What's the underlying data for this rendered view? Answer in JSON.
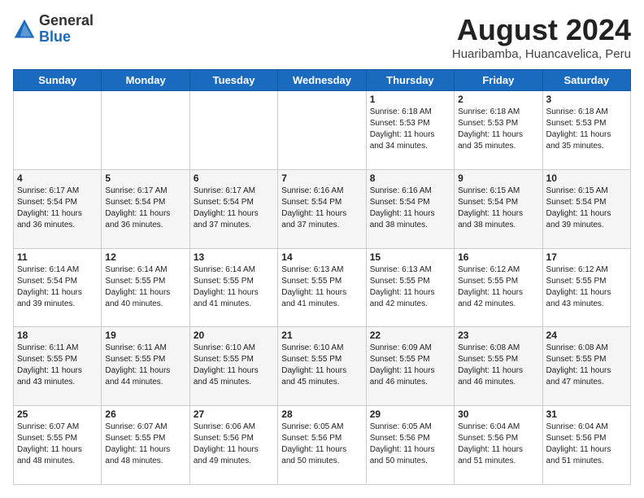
{
  "header": {
    "logo_general": "General",
    "logo_blue": "Blue",
    "month_year": "August 2024",
    "location": "Huaribamba, Huancavelica, Peru"
  },
  "days_of_week": [
    "Sunday",
    "Monday",
    "Tuesday",
    "Wednesday",
    "Thursday",
    "Friday",
    "Saturday"
  ],
  "weeks": [
    [
      {
        "day": "",
        "info": ""
      },
      {
        "day": "",
        "info": ""
      },
      {
        "day": "",
        "info": ""
      },
      {
        "day": "",
        "info": ""
      },
      {
        "day": "1",
        "info": "Sunrise: 6:18 AM\nSunset: 5:53 PM\nDaylight: 11 hours\nand 34 minutes."
      },
      {
        "day": "2",
        "info": "Sunrise: 6:18 AM\nSunset: 5:53 PM\nDaylight: 11 hours\nand 35 minutes."
      },
      {
        "day": "3",
        "info": "Sunrise: 6:18 AM\nSunset: 5:53 PM\nDaylight: 11 hours\nand 35 minutes."
      }
    ],
    [
      {
        "day": "4",
        "info": "Sunrise: 6:17 AM\nSunset: 5:54 PM\nDaylight: 11 hours\nand 36 minutes."
      },
      {
        "day": "5",
        "info": "Sunrise: 6:17 AM\nSunset: 5:54 PM\nDaylight: 11 hours\nand 36 minutes."
      },
      {
        "day": "6",
        "info": "Sunrise: 6:17 AM\nSunset: 5:54 PM\nDaylight: 11 hours\nand 37 minutes."
      },
      {
        "day": "7",
        "info": "Sunrise: 6:16 AM\nSunset: 5:54 PM\nDaylight: 11 hours\nand 37 minutes."
      },
      {
        "day": "8",
        "info": "Sunrise: 6:16 AM\nSunset: 5:54 PM\nDaylight: 11 hours\nand 38 minutes."
      },
      {
        "day": "9",
        "info": "Sunrise: 6:15 AM\nSunset: 5:54 PM\nDaylight: 11 hours\nand 38 minutes."
      },
      {
        "day": "10",
        "info": "Sunrise: 6:15 AM\nSunset: 5:54 PM\nDaylight: 11 hours\nand 39 minutes."
      }
    ],
    [
      {
        "day": "11",
        "info": "Sunrise: 6:14 AM\nSunset: 5:54 PM\nDaylight: 11 hours\nand 39 minutes."
      },
      {
        "day": "12",
        "info": "Sunrise: 6:14 AM\nSunset: 5:55 PM\nDaylight: 11 hours\nand 40 minutes."
      },
      {
        "day": "13",
        "info": "Sunrise: 6:14 AM\nSunset: 5:55 PM\nDaylight: 11 hours\nand 41 minutes."
      },
      {
        "day": "14",
        "info": "Sunrise: 6:13 AM\nSunset: 5:55 PM\nDaylight: 11 hours\nand 41 minutes."
      },
      {
        "day": "15",
        "info": "Sunrise: 6:13 AM\nSunset: 5:55 PM\nDaylight: 11 hours\nand 42 minutes."
      },
      {
        "day": "16",
        "info": "Sunrise: 6:12 AM\nSunset: 5:55 PM\nDaylight: 11 hours\nand 42 minutes."
      },
      {
        "day": "17",
        "info": "Sunrise: 6:12 AM\nSunset: 5:55 PM\nDaylight: 11 hours\nand 43 minutes."
      }
    ],
    [
      {
        "day": "18",
        "info": "Sunrise: 6:11 AM\nSunset: 5:55 PM\nDaylight: 11 hours\nand 43 minutes."
      },
      {
        "day": "19",
        "info": "Sunrise: 6:11 AM\nSunset: 5:55 PM\nDaylight: 11 hours\nand 44 minutes."
      },
      {
        "day": "20",
        "info": "Sunrise: 6:10 AM\nSunset: 5:55 PM\nDaylight: 11 hours\nand 45 minutes."
      },
      {
        "day": "21",
        "info": "Sunrise: 6:10 AM\nSunset: 5:55 PM\nDaylight: 11 hours\nand 45 minutes."
      },
      {
        "day": "22",
        "info": "Sunrise: 6:09 AM\nSunset: 5:55 PM\nDaylight: 11 hours\nand 46 minutes."
      },
      {
        "day": "23",
        "info": "Sunrise: 6:08 AM\nSunset: 5:55 PM\nDaylight: 11 hours\nand 46 minutes."
      },
      {
        "day": "24",
        "info": "Sunrise: 6:08 AM\nSunset: 5:55 PM\nDaylight: 11 hours\nand 47 minutes."
      }
    ],
    [
      {
        "day": "25",
        "info": "Sunrise: 6:07 AM\nSunset: 5:55 PM\nDaylight: 11 hours\nand 48 minutes."
      },
      {
        "day": "26",
        "info": "Sunrise: 6:07 AM\nSunset: 5:55 PM\nDaylight: 11 hours\nand 48 minutes."
      },
      {
        "day": "27",
        "info": "Sunrise: 6:06 AM\nSunset: 5:56 PM\nDaylight: 11 hours\nand 49 minutes."
      },
      {
        "day": "28",
        "info": "Sunrise: 6:05 AM\nSunset: 5:56 PM\nDaylight: 11 hours\nand 50 minutes."
      },
      {
        "day": "29",
        "info": "Sunrise: 6:05 AM\nSunset: 5:56 PM\nDaylight: 11 hours\nand 50 minutes."
      },
      {
        "day": "30",
        "info": "Sunrise: 6:04 AM\nSunset: 5:56 PM\nDaylight: 11 hours\nand 51 minutes."
      },
      {
        "day": "31",
        "info": "Sunrise: 6:04 AM\nSunset: 5:56 PM\nDaylight: 11 hours\nand 51 minutes."
      }
    ]
  ]
}
